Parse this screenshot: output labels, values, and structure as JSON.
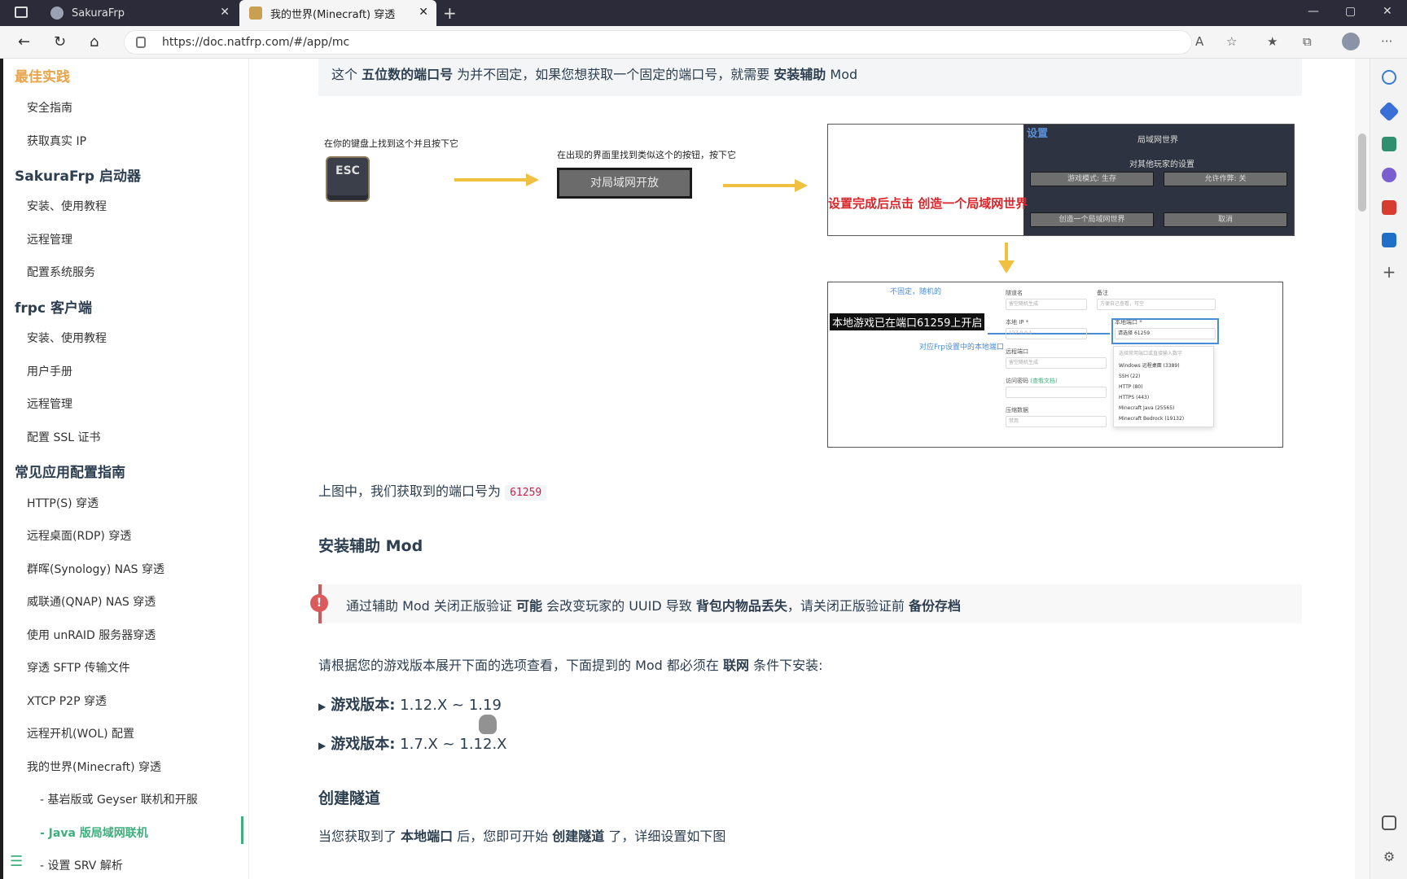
{
  "tabs": [
    {
      "label": "SakuraFrp"
    },
    {
      "label": "我的世界(Minecraft) 穿透"
    }
  ],
  "address": {
    "url": "https://doc.natfrp.com/#/app/mc"
  },
  "sidebar": {
    "items": [
      {
        "label": "最佳实践"
      },
      {
        "label": "安全指南"
      },
      {
        "label": "获取真实 IP"
      },
      {
        "label": "SakuraFrp 启动器"
      },
      {
        "label": "安装、使用教程"
      },
      {
        "label": "远程管理"
      },
      {
        "label": "配置系统服务"
      },
      {
        "label": "frpc 客户端"
      },
      {
        "label": "安装、使用教程"
      },
      {
        "label": "用户手册"
      },
      {
        "label": "远程管理"
      },
      {
        "label": "配置 SSL 证书"
      },
      {
        "label": "常见应用配置指南"
      },
      {
        "label": "HTTP(S) 穿透"
      },
      {
        "label": "远程桌面(RDP) 穿透"
      },
      {
        "label": "群晖(Synology) NAS 穿透"
      },
      {
        "label": "威联通(QNAP) NAS 穿透"
      },
      {
        "label": "使用 unRAID 服务器穿透"
      },
      {
        "label": "穿透 SFTP 传输文件"
      },
      {
        "label": "XTCP P2P 穿透"
      },
      {
        "label": "远程开机(WOL) 配置"
      },
      {
        "label": "我的世界(Minecraft) 穿透"
      },
      {
        "label": "- 基岩版或 Geyser 联机和开服"
      },
      {
        "label": "- Java 版局域网联机"
      },
      {
        "label": "- 设置 SRV 解析"
      }
    ]
  },
  "content": {
    "tip": {
      "p1": "这个 ",
      "b1": "五位数的端口号",
      "p2": " 为并不固定，如果您想获取一个固定的端口号，就需要 ",
      "b2": "安装辅助",
      "p3": " Mod"
    },
    "figure": {
      "esc_caption": "在你的键盘上找到这个并且按下它",
      "esc_key": "ESC",
      "lan_caption": "在出现的界面里找到类似这个的按钮，按下它",
      "lan_button": "对局域网开放",
      "img1": {
        "settings_label": "设置",
        "lan_world": "局域网世界",
        "other_players": "对其他玩家的设置",
        "game_mode": "游戏模式: 生存",
        "allow_cheats": "允许作弊: 关",
        "red_note": "设置完成后点击 创造一个局域网世界",
        "create_lan": "创造一个局域网世界",
        "cancel": "取消"
      },
      "img2": {
        "random_note": "不固定，随机的",
        "port_note_a": "本地游戏已在端口",
        "port_value": "61259",
        "port_note_b": "上开启",
        "local_port_note": "对应Frp设置中的本地端口",
        "tunnel_name": "隧道名",
        "remark": "备注",
        "local_ip": "本地 IP *",
        "local_port": "本地端口 *",
        "remote_port": "远程端口",
        "access_pw": "访问密码",
        "view_docs": "(查看文档)",
        "compress": "压缩数据",
        "name_ph": "留空随机生成",
        "remark_ph": "方便自己查看，可空",
        "ip_value": "127.0.0.1",
        "select_ph": "请选择",
        "options": [
          "Windows 远程桌面 (3389)",
          "SSH (22)",
          "HTTP (80)",
          "HTTPS (443)",
          "Minecraft Java (25565)",
          "Minecraft Bedrock (19132)"
        ],
        "dropdown_hint": "选择常用端口或直接输入数字",
        "remote_ph": "留空随机生成",
        "compress_value": "禁用"
      }
    },
    "port_line": {
      "text": "上图中，我们获取到的端口号为",
      "code": "61259"
    },
    "h_mod": "安装辅助 Mod",
    "warning": {
      "p1": "通过辅助 Mod 关闭正版验证 ",
      "b1": "可能",
      "p2": " 会改变玩家的 UUID 导致 ",
      "b2": "背包内物品丢失",
      "p3": "，请关闭正版验证前 ",
      "b3": "备份存档"
    },
    "versions_intro": {
      "p1": "请根据您的游戏版本展开下面的选项查看，下面提到的 Mod 都必须在 ",
      "b1": "联网",
      "p2": " 条件下安装:"
    },
    "summary1": {
      "label": "游戏版本:",
      "value": " 1.12.X ~ 1.19"
    },
    "summary2": {
      "label": "游戏版本:",
      "value": " 1.7.X ~ 1.12.X"
    },
    "h_tunnel": "创建隧道",
    "tunnel_line": {
      "p1": "当您获取到了 ",
      "b1": "本地端口",
      "p2": " 后，您即可开始 ",
      "b2": "创建隧道",
      "p3": " 了，详细设置如下图"
    }
  },
  "colors": {
    "accent": "#3eaf7c",
    "heading_orange": "#e8a44a",
    "danger": "#d95b5b",
    "code": "#c7254e"
  }
}
